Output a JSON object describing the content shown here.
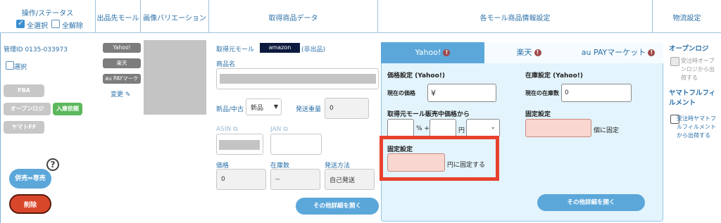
{
  "header": {
    "col_ops": "操作/ステータス",
    "select_all": "全選択",
    "deselect_all": "全解除",
    "col_mall": "出品先モール",
    "col_variation": "画像バリエーション",
    "col_product": "取得商品データ",
    "col_mall_info": "各モール商品情報設定",
    "col_logistics": "物流設定"
  },
  "left": {
    "manage_id": "管理ID 0135-033973",
    "select_label": "選択",
    "fba": "FBA",
    "open_logi": "オープンロジ",
    "inbound": "入庫依頼",
    "yamato": "ヤマトFF",
    "help_icon": "?",
    "toggle_button": "併売⇔専売",
    "delete_button": "削除"
  },
  "malls": {
    "yahoo": "Yahoo!",
    "rakuten": "楽天",
    "aupay": "au PAYマーケッ",
    "change": "変更"
  },
  "product": {
    "source_mall_label": "取得元モール",
    "source_mall_value": "amazon",
    "unlisted": "(非出品)",
    "name_label": "商品名",
    "condition_label": "新品/中古",
    "condition_value": "新品",
    "weight_label": "発送重量",
    "weight_value": "0",
    "asin_label": "ASIN",
    "jan_label": "JAN",
    "price_label": "価格",
    "stock_label": "在庫数",
    "ship_label": "発送方法",
    "price_value": "0",
    "stock_value": "--",
    "ship_value": "自己発送",
    "more_button": "その他詳細を開く"
  },
  "mall_panel": {
    "tabs": [
      {
        "label": "Yahoo!",
        "active": true
      },
      {
        "label": "楽天",
        "active": false
      },
      {
        "label": "au PAYマーケット",
        "active": false
      }
    ],
    "price_section": "価格設定 (Yahoo!)",
    "current_price_label": "現在の価格",
    "current_price_value": "¥",
    "stock_section": "在庫設定 (Yahoo!)",
    "current_stock_label": "現在の在庫数",
    "current_stock_value": "0",
    "from_source_label": "取得元モール販売中価格から",
    "pct_plus": "% +",
    "yen": "円",
    "fixed_label_right": "固定設定",
    "fixed_stock_suffix": "個に固定",
    "fixed_label_left": "固定設定",
    "fixed_price_suffix": "円に固定する",
    "more_button": "その他詳細を開く"
  },
  "logistics": {
    "open_logi_title": "オープンロジ",
    "open_logi_option": "受注時オープンロジから出荷する",
    "yamato_title": "ヤマトフルフィルメント",
    "yamato_option": "受注時ヤマトフルフィルメントから出荷する"
  },
  "colors": {
    "accent": "#5ba7da",
    "highlight_frame": "#e8412e",
    "delete": "#d9472b"
  }
}
